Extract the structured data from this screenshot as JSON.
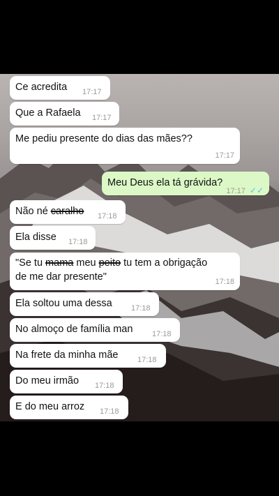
{
  "messages": [
    {
      "text": "Ce acredita",
      "time": "17:17",
      "dir": "in"
    },
    {
      "text": "Que a Rafaela",
      "time": "17:17",
      "dir": "in"
    },
    {
      "text": "Me pediu presente do dias das mães??",
      "time": "17:17",
      "dir": "in"
    },
    {
      "text": "Meu Deus ela tá grávida?",
      "time": "17:17",
      "dir": "out",
      "status": "read-double-check-icon"
    },
    {
      "text_before": "Não né ",
      "text_struck": "caralho",
      "time": "17:18",
      "dir": "in"
    },
    {
      "text": "Ela disse",
      "time": "17:18",
      "dir": "in"
    },
    {
      "line1_a": "\"Se tu ",
      "line1_struck1": "mama",
      "line1_b": " meu ",
      "line1_struck2": "peito",
      "line1_c": " tu tem a obrigação",
      "line2": "de me dar presente\"",
      "time": "17:18",
      "dir": "in"
    },
    {
      "text": "Ela soltou uma dessa",
      "time": "17:18",
      "dir": "in"
    },
    {
      "text": "No almoço de família man",
      "time": "17:18",
      "dir": "in"
    },
    {
      "text": "Na frete da minha mãe",
      "time": "17:18",
      "dir": "in"
    },
    {
      "text": "Do meu irmão",
      "time": "17:18",
      "dir": "in"
    },
    {
      "text": "E do meu arroz",
      "time": "17:18",
      "dir": "in"
    }
  ],
  "colors": {
    "incoming": "#ffffff",
    "outgoing": "#dcf8c6",
    "read_ticks": "#4fc3f7",
    "background": "#000000"
  }
}
